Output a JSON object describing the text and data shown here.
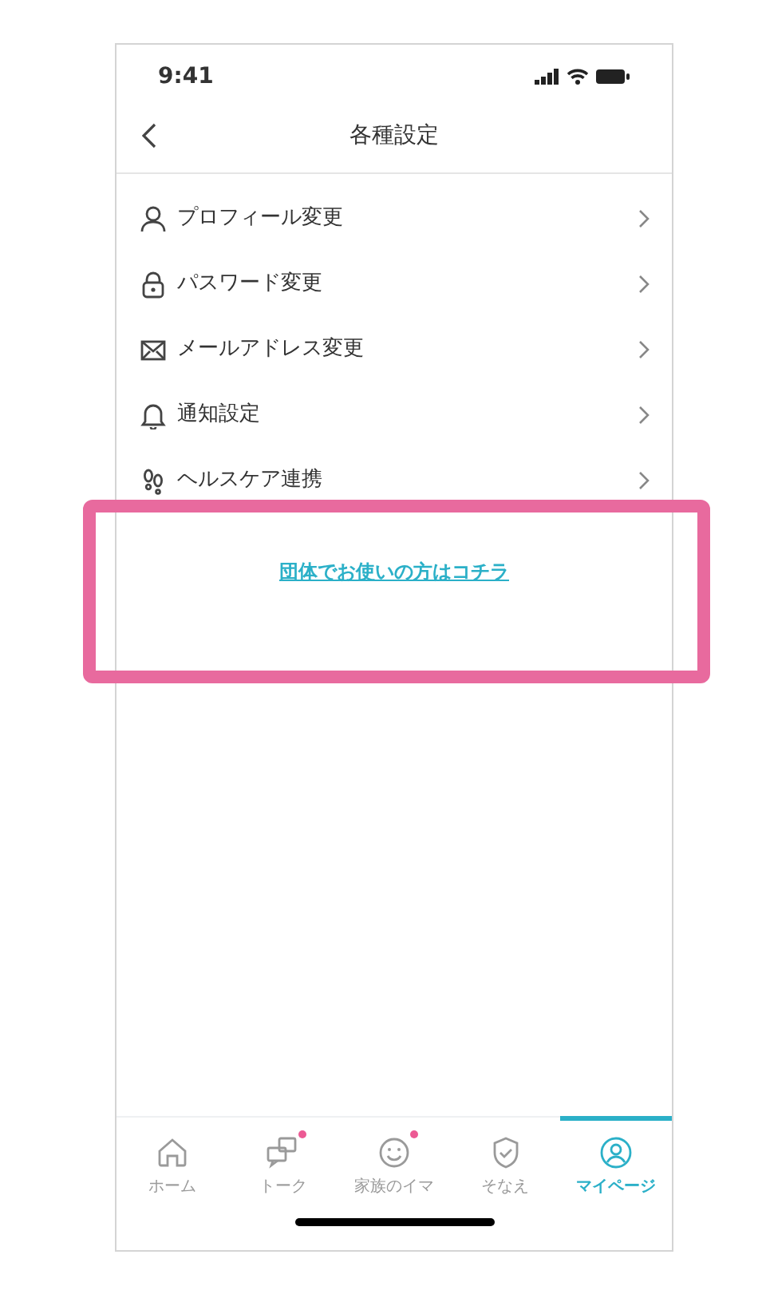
{
  "status_bar": {
    "time": "9:41"
  },
  "header": {
    "title": "各種設定"
  },
  "menu_items": [
    {
      "label": "プロフィール変更"
    },
    {
      "label": "パスワード変更"
    },
    {
      "label": "メールアドレス変更"
    },
    {
      "label": "通知設定"
    },
    {
      "label": "ヘルスケア連携"
    }
  ],
  "group_link": {
    "label": "団体でお使いの方はコチラ"
  },
  "highlight": true,
  "tab_bar": [
    {
      "label": "ホーム",
      "selected": false,
      "badge": false
    },
    {
      "label": "トーク",
      "selected": false,
      "badge": true
    },
    {
      "label": "家族のイマ",
      "selected": false,
      "badge": true
    },
    {
      "label": "そなえ",
      "selected": false,
      "badge": false
    },
    {
      "label": "マイページ",
      "selected": true,
      "badge": false
    }
  ]
}
